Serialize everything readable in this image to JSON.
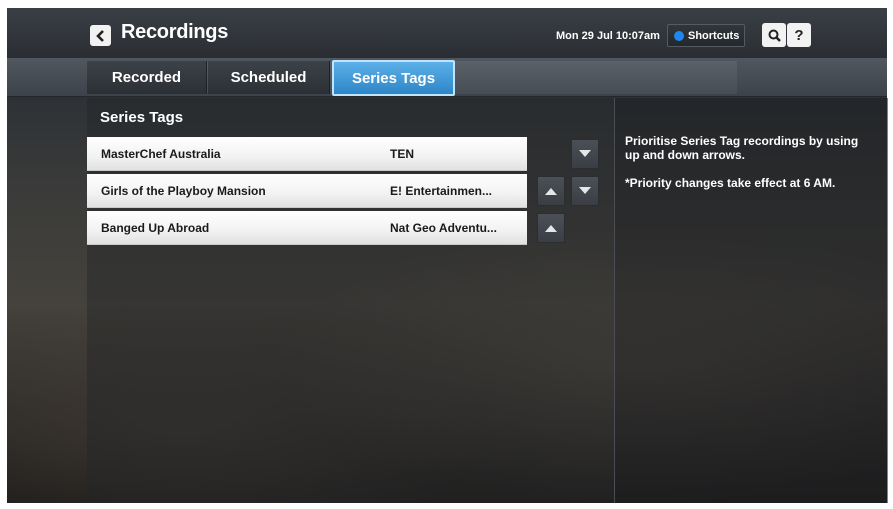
{
  "header": {
    "title": "Recordings",
    "datetime": "Mon 29 Jul 10:07am",
    "shortcuts_label": "Shortcuts",
    "search_label": "Q",
    "help_label": "?"
  },
  "tabs": [
    {
      "label": "Recorded",
      "active": false
    },
    {
      "label": "Scheduled",
      "active": false
    },
    {
      "label": "Series Tags",
      "active": true
    }
  ],
  "section": {
    "heading": "Series Tags",
    "rows": [
      {
        "name": "MasterChef Australia",
        "channel": "TEN"
      },
      {
        "name": "Girls of the Playboy Mansion",
        "channel": "E! Entertainmen..."
      },
      {
        "name": "Banged Up Abroad",
        "channel": "Nat Geo Adventu..."
      }
    ]
  },
  "help": {
    "line1": "Prioritise Series Tag recordings by using up and down arrows.",
    "line2": "*Priority changes take effect at 6 AM."
  },
  "colors": {
    "accent": "#3a96d8",
    "shortcuts_dot": "#1e88f0"
  }
}
